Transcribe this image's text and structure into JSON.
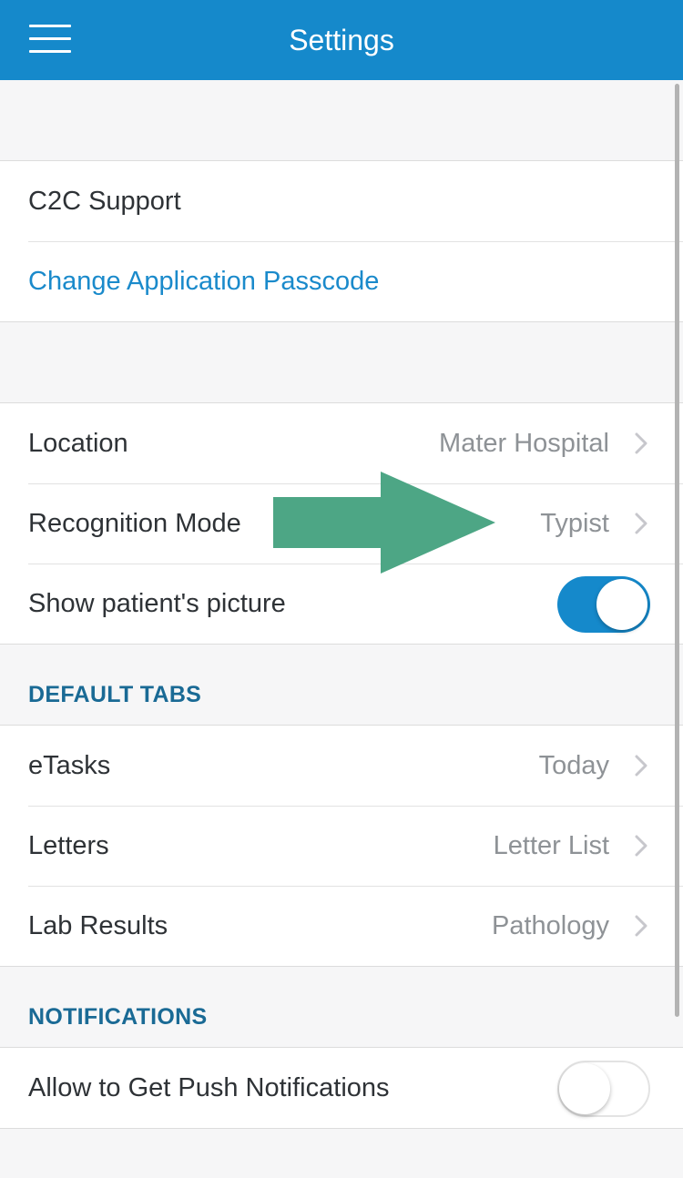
{
  "navbar": {
    "title": "Settings",
    "background": "#1589cb",
    "menu_icon": "hamburger-icon"
  },
  "group1": {
    "items": [
      {
        "label": "C2C Support"
      },
      {
        "label": "Change Application Passcode"
      }
    ]
  },
  "group2": {
    "items": [
      {
        "label": "Location",
        "value": "Mater Hospital"
      },
      {
        "label": "Recognition Mode",
        "value": "Typist"
      },
      {
        "label": "Show patient's picture",
        "toggle": "on"
      }
    ]
  },
  "default_tabs": {
    "header": "DEFAULT TABS",
    "items": [
      {
        "label": "eTasks",
        "value": "Today"
      },
      {
        "label": "Letters",
        "value": "Letter List"
      },
      {
        "label": "Lab Results",
        "value": "Pathology"
      }
    ]
  },
  "notifications": {
    "header": "NOTIFICATIONS",
    "items": [
      {
        "label": "Allow to Get Push Notifications",
        "toggle": "off"
      }
    ]
  },
  "colors": {
    "accent": "#1589cb",
    "link": "#1a8acb",
    "section_header": "#1a6a95",
    "annotation_arrow": "#4da685"
  },
  "annotation": {
    "icon": "arrow-right-icon"
  }
}
